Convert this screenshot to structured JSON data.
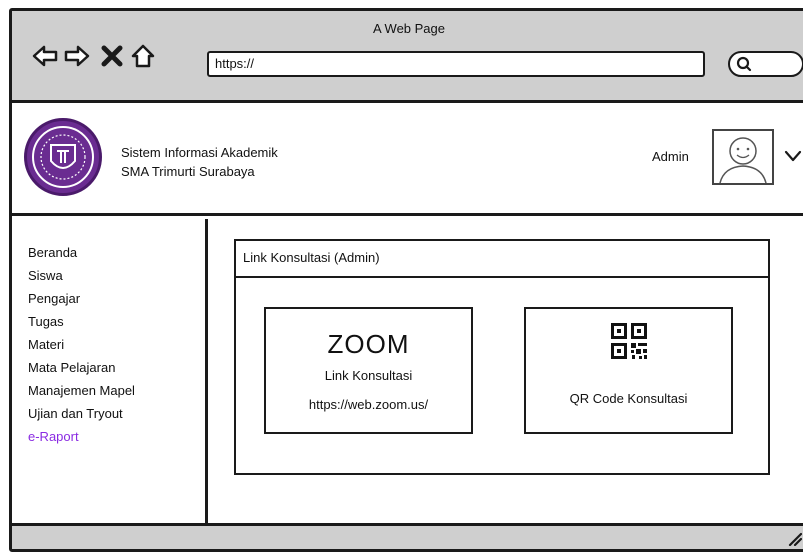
{
  "window": {
    "title": "A Web Page"
  },
  "browser": {
    "url": "https://",
    "back_icon": "arrow-left-icon",
    "forward_icon": "arrow-right-icon",
    "stop_icon": "close-icon",
    "home_icon": "home-icon",
    "search_icon": "search-icon"
  },
  "header": {
    "school_logo": "school-crest-logo",
    "title_line1": "Sistem Informasi Akademik",
    "title_line2": "SMA Trimurti Surabaya",
    "user_name": "Admin",
    "avatar_icon": "user-avatar-icon",
    "menu_icon": "chevron-down-icon"
  },
  "sidebar": {
    "items": [
      {
        "label": "Beranda",
        "active": false
      },
      {
        "label": "Siswa",
        "active": false
      },
      {
        "label": "Pengajar",
        "active": false
      },
      {
        "label": "Tugas",
        "active": false
      },
      {
        "label": "Materi",
        "active": false
      },
      {
        "label": "Mata Pelajaran",
        "active": false
      },
      {
        "label": "Manajemen Mapel",
        "active": false
      },
      {
        "label": "Ujian dan Tryout",
        "active": false
      },
      {
        "label": "e-Raport",
        "active": true
      }
    ],
    "active_color": "#8a2be2"
  },
  "main": {
    "panel_title": "Link Konsultasi (Admin)",
    "zoom_card": {
      "brand": "ZOOM",
      "label": "Link Konsultasi",
      "url": "https://web.zoom.us/"
    },
    "qr_card": {
      "icon": "qr-code-icon",
      "label": "QR Code Konsultasi"
    }
  },
  "colors": {
    "chrome": "#cfcfcf",
    "border": "#1a1a1a",
    "logo": "#6a2c91",
    "active_link": "#8a2be2"
  }
}
